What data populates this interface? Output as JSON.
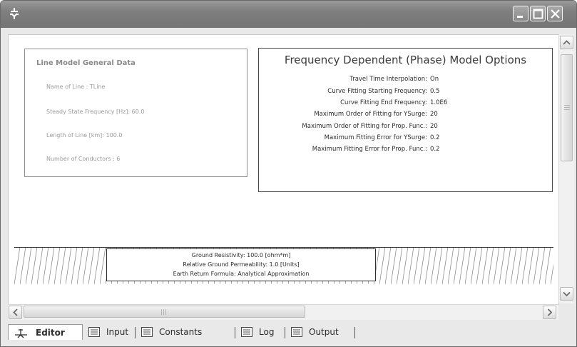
{
  "window": {
    "app_icon": "plug-connector-icon",
    "buttons": [
      "minimize-icon",
      "maximize-icon",
      "close-icon"
    ]
  },
  "line_model": {
    "title": "Line Model General Data",
    "name": "Name of Line : TLine",
    "frequency": "Steady State Frequency [Hz]: 60.0",
    "length": "Length of Line [km]: 100.0",
    "conductors": "Number of Conductors : 6"
  },
  "freq_options": {
    "title": "Frequency Dependent (Phase) Model Options",
    "rows": [
      {
        "label": "Travel Time Interpolation:",
        "value": "On"
      },
      {
        "label": "Curve Fitting Starting Frequency:",
        "value": "0.5"
      },
      {
        "label": "Curve Fitting End Frequency:",
        "value": "1.0E6"
      },
      {
        "label": "Maximum Order of Fitting for YSurge:",
        "value": "20"
      },
      {
        "label": "Maximum Order of Fitting for Prop. Func.:",
        "value": "20"
      },
      {
        "label": "Maximum Fitting Error for YSurge:",
        "value": "0.2"
      },
      {
        "label": "Maximum Fitting Error for Prop. Func.:",
        "value": "0.2"
      }
    ]
  },
  "ground": {
    "resistivity": "Ground Resistivity: 100.0 [ohm*m]",
    "permeability": "Relative Ground Permeability: 1.0 [Units]",
    "formula": "Earth Return Formula: Analytical Approximation"
  },
  "tabs": [
    {
      "label": "Editor",
      "icon": "editor-icon"
    },
    {
      "label": "Input",
      "icon": "document-icon"
    },
    {
      "label": "Constants",
      "icon": "document-icon"
    },
    {
      "label": "Log",
      "icon": "document-icon"
    },
    {
      "label": "Output",
      "icon": "document-icon"
    }
  ]
}
